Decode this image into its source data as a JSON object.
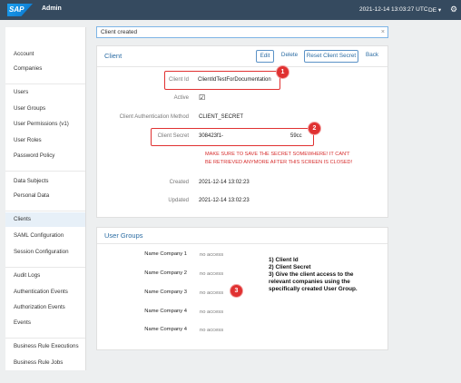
{
  "header": {
    "brand": "SAP",
    "app_title": "Admin",
    "timestamp": "2021-12-14 13:03:27 UTC",
    "language": "DE",
    "settings_icon": "gear-icon"
  },
  "sidebar": {
    "groups": [
      [
        "Account",
        "Companies"
      ],
      [
        "Users",
        "User Groups",
        "User Permissions (v1)",
        "User Roles",
        "Password Policy"
      ],
      [
        "Data Subjects",
        "Personal Data"
      ],
      [
        "Clients",
        "SAML Configuration",
        "Session Configuration"
      ],
      [
        "Audit Logs",
        "Authentication Events",
        "Authorization Events",
        "Events"
      ],
      [
        "Business Rule Executions",
        "Business Rule Jobs"
      ]
    ],
    "active": "Clients"
  },
  "search": {
    "value": "Client created",
    "clear_icon": "close-icon"
  },
  "client_panel": {
    "title": "Client",
    "buttons": {
      "edit": "Edit",
      "delete": "Delete",
      "reset": "Reset Client Secret",
      "back": "Back"
    },
    "fields": {
      "client_id_label": "Client Id",
      "client_id_value": "ClientIdTestForDocumentation",
      "active_label": "Active",
      "auth_method_label": "Client Authentication Method",
      "auth_method_value": "CLIENT_SECRET",
      "secret_label": "Client Secret",
      "secret_value_start": "308423f1-",
      "secret_value_end": "59cc",
      "warning_line1": "MAKE SURE TO SAVE THE SECRET SOMEWHERE! IT CAN'T",
      "warning_line2": "BE RETRIEVED ANYMORE AFTER THIS SCREEN IS CLOSED!",
      "created_label": "Created",
      "created_value": "2021-12-14 13:02:23",
      "updated_label": "Updated",
      "updated_value": "2021-12-14 13:02:23"
    }
  },
  "user_groups_panel": {
    "title": "User Groups",
    "rows": [
      {
        "name": "Name Company 1",
        "value": "no access"
      },
      {
        "name": "Name Company 2",
        "value": "no access"
      },
      {
        "name": "Name Company 3",
        "value": "no access"
      },
      {
        "name": "Name Company 4",
        "value": "no access"
      },
      {
        "name": "Name Company 4",
        "value": "no access"
      }
    ]
  },
  "annotations": {
    "badges": [
      "1",
      "2",
      "3"
    ],
    "note": [
      "1) Client Id",
      "2) Client Secret",
      "3) Give the client access to the",
      "relevant companies using the",
      "specifically created User Group."
    ],
    "accent_color": "#e03131"
  }
}
